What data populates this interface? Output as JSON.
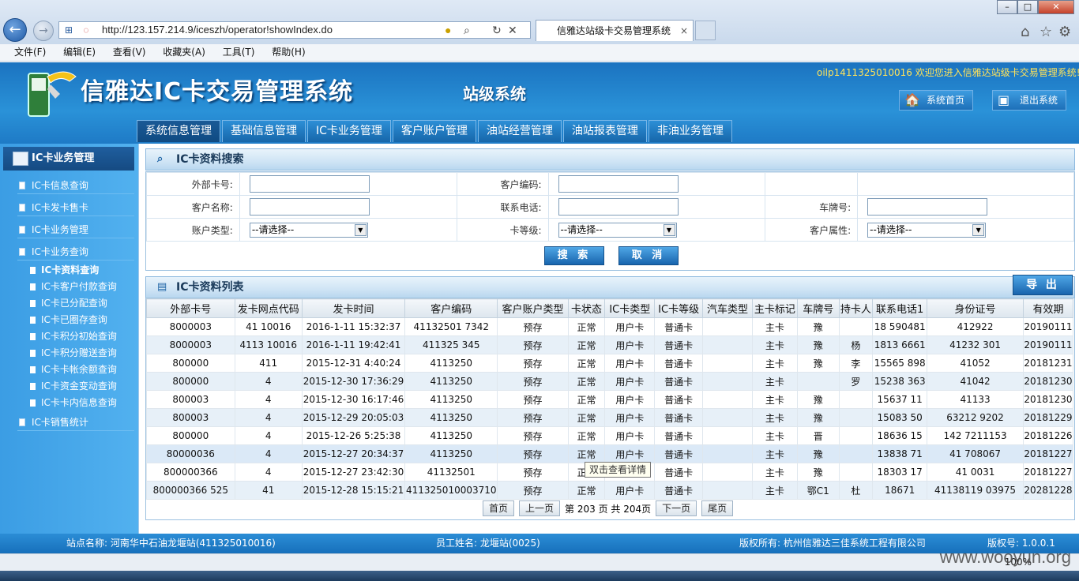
{
  "browser": {
    "url": "http://123.157.214.9/iceszh/operator!showIndex.do",
    "tab_title": "信雅达站级卡交易管理系统",
    "menu": [
      "文件(F)",
      "编辑(E)",
      "查看(V)",
      "收藏夹(A)",
      "工具(T)",
      "帮助(H)"
    ],
    "zoom": "100%"
  },
  "header": {
    "title": "信雅达IC卡交易管理系统",
    "subtitle": "站级系统",
    "welcome": "oilp1411325010016 欢迎您进入信雅达站级卡交易管理系统!",
    "home_label": "系统首页",
    "exit_label": "退出系统"
  },
  "nav": [
    "系统信息管理",
    "基础信息管理",
    "IC卡业务管理",
    "客户账户管理",
    "油站经营管理",
    "油站报表管理",
    "非油业务管理"
  ],
  "sidebar": {
    "heading": "IC卡业务管理",
    "items": [
      "IC卡信息查询",
      "IC卡发卡售卡",
      "IC卡业务管理",
      "IC卡业务查询"
    ],
    "subitems": [
      "IC卡资料查询",
      "IC卡客户付款查询",
      "IC卡已分配查询",
      "IC卡已圈存查询",
      "IC卡积分初始查询",
      "IC卡积分赠送查询",
      "IC卡卡帐余额查询",
      "IC卡资金变动查询",
      "IC卡卡内信息查询"
    ],
    "last_item": "IC卡销售统计"
  },
  "search": {
    "title": "IC卡资料搜索",
    "labels": {
      "ext_card": "外部卡号:",
      "cust_code": "客户编码:",
      "cust_name": "客户名称:",
      "phone": "联系电话:",
      "plate": "车牌号:",
      "acct_type": "账户类型:",
      "card_level": "卡等级:",
      "cust_attr": "客户属性:"
    },
    "select_default": "--请选择--",
    "search_btn": "搜 索",
    "cancel_btn": "取 消"
  },
  "list": {
    "title": "IC卡资料列表",
    "export_btn": "导 出",
    "columns": [
      "外部卡号",
      "发卡网点代码",
      "发卡时间",
      "客户编码",
      "客户账户类型",
      "卡状态",
      "IC卡类型",
      "IC卡等级",
      "汽车类型",
      "主卡标记",
      "车牌号",
      "持卡人",
      "联系电话1",
      "身份证号",
      "有效期"
    ],
    "rows": [
      [
        "8000003",
        "41        10016",
        "2016-1-11 15:32:37",
        "41132501     7342",
        "预存",
        "正常",
        "用户卡",
        "普通卡",
        "",
        "主卡",
        "豫",
        "",
        "18     590481",
        "412922",
        "20190111"
      ],
      [
        "8000003",
        "4113    10016",
        "2016-1-11 19:42:41",
        "411325       345",
        "预存",
        "正常",
        "用户卡",
        "普通卡",
        "",
        "主卡",
        "豫",
        "杨",
        "1813     6661",
        "41232       301",
        "20190111"
      ],
      [
        "800000",
        "411",
        "2015-12-31 4:40:24",
        "4113250",
        "预存",
        "正常",
        "用户卡",
        "普通卡",
        "",
        "主卡",
        "豫",
        "李",
        "15565     898",
        "41052",
        "20181231"
      ],
      [
        "800000",
        "4",
        "2015-12-30 17:36:29",
        "4113250",
        "预存",
        "正常",
        "用户卡",
        "普通卡",
        "",
        "主卡",
        "",
        "罗",
        "15238     363",
        "41042",
        "20181230"
      ],
      [
        "800003",
        "4",
        "2015-12-30 16:17:46",
        "4113250",
        "预存",
        "正常",
        "用户卡",
        "普通卡",
        "",
        "主卡",
        "豫",
        "",
        "15637     11",
        "41133",
        "20181230"
      ],
      [
        "800003",
        "4",
        "2015-12-29 20:05:03",
        "4113250",
        "预存",
        "正常",
        "用户卡",
        "普通卡",
        "",
        "主卡",
        "豫",
        "",
        "15083     50",
        "63212     9202",
        "20181229"
      ],
      [
        "800000",
        "4",
        "2015-12-26 5:25:38",
        "4113250",
        "预存",
        "正常",
        "用户卡",
        "普通卡",
        "",
        "主卡",
        "晋",
        "",
        "18636     15",
        "142     7211153",
        "20181226"
      ],
      [
        "80000036",
        "4",
        "2015-12-27 20:34:37",
        "4113250",
        "预存",
        "正常",
        "用户卡",
        "普通卡",
        "",
        "主卡",
        "豫",
        "",
        "13838     71",
        "41     708067",
        "20181227"
      ],
      [
        "800000366",
        "4",
        "2015-12-27 23:42:30",
        "41132501",
        "预存",
        "正常",
        "用户卡",
        "普通卡",
        "",
        "主卡",
        "豫",
        "",
        "18303     17",
        "41     0031",
        "20181227"
      ],
      [
        "800000366   525",
        "41",
        "2015-12-28 15:15:21",
        "411325010003710",
        "预存",
        "正常",
        "用户卡",
        "普通卡",
        "",
        "主卡",
        "鄂C1",
        "杜",
        "18671",
        "41138119     03975",
        "20281228"
      ]
    ],
    "pager": {
      "first": "首页",
      "prev": "上一页",
      "info": "第 203 页 共 204页",
      "next": "下一页",
      "last": "尾页"
    },
    "tooltip": "双击查看详情"
  },
  "footer": {
    "station": "站点名称: 河南华中石油龙堰站(411325010016)",
    "staff": "员工姓名: 龙堰站(0025)",
    "copyright": "版权所有: 杭州信雅达三佳系统工程有限公司",
    "version": "版权号: 1.0.0.1"
  },
  "watermark": "www.wooyun.org"
}
